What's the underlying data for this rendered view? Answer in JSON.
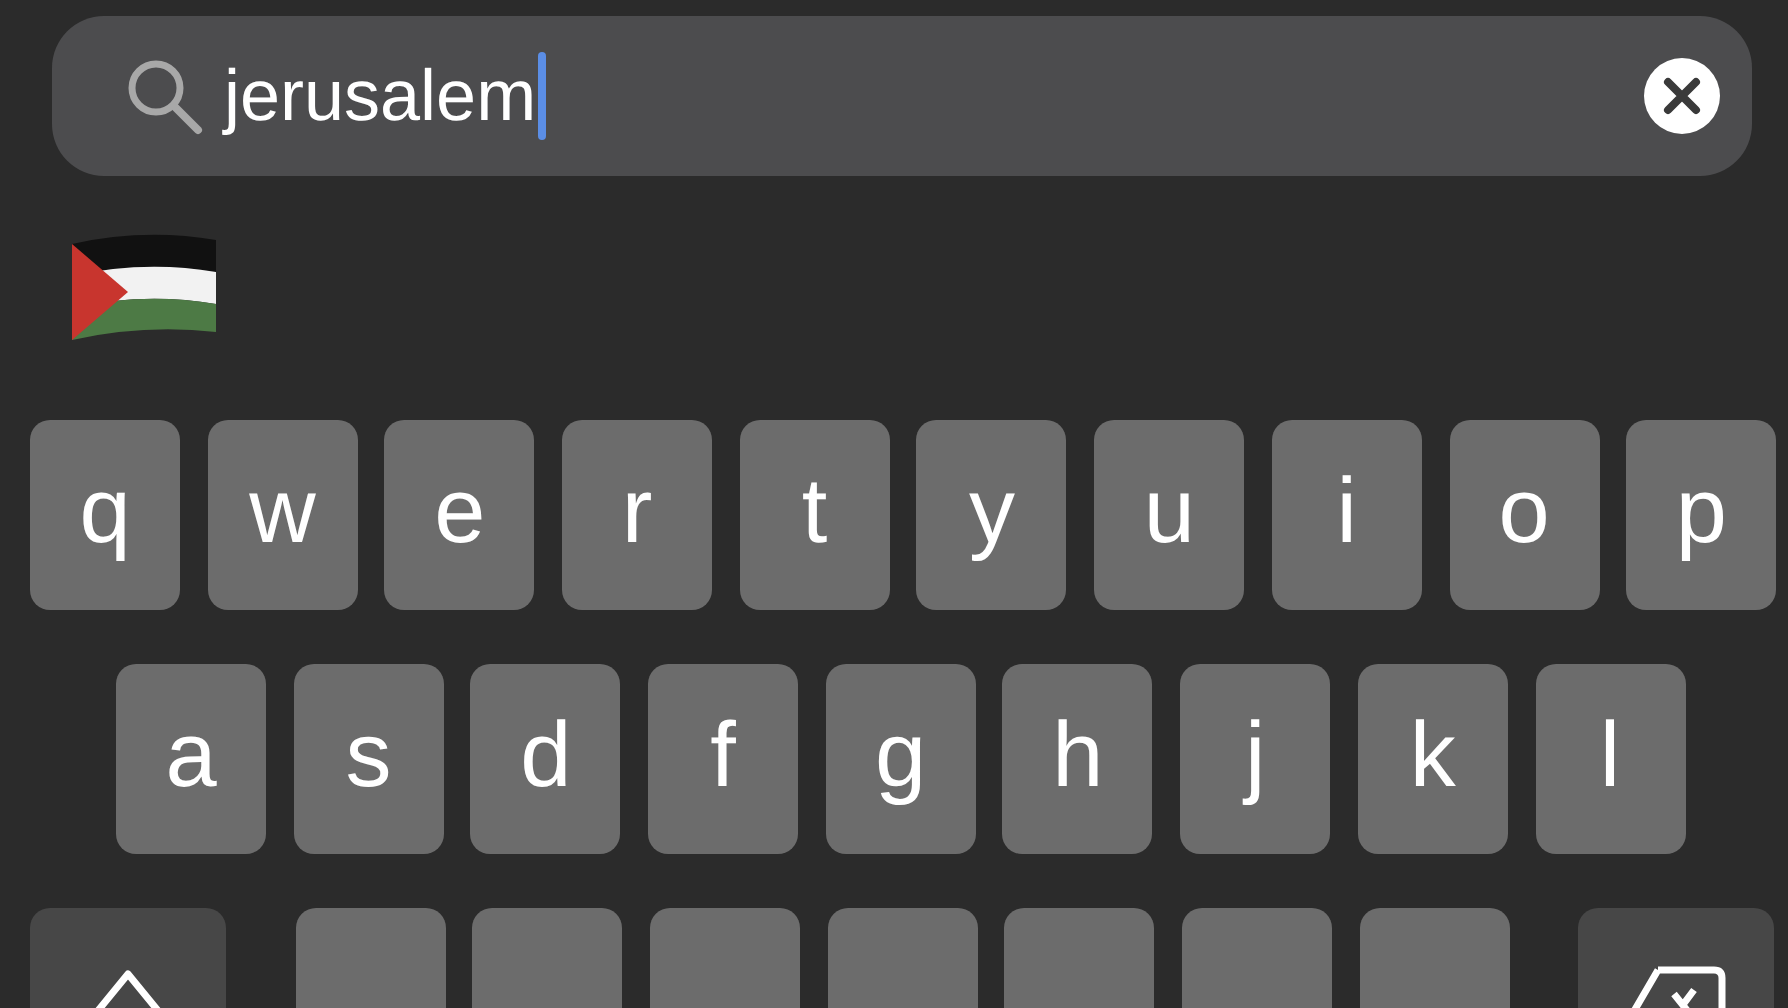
{
  "search": {
    "value": "jerusalem",
    "focused": true
  },
  "keyboard": {
    "rows": [
      {
        "keys": [
          {
            "kind": "letter",
            "label": "q"
          },
          {
            "kind": "letter",
            "label": "w"
          },
          {
            "kind": "letter",
            "label": "e"
          },
          {
            "kind": "letter",
            "label": "r"
          },
          {
            "kind": "letter",
            "label": "t"
          },
          {
            "kind": "letter",
            "label": "y"
          },
          {
            "kind": "letter",
            "label": "u"
          },
          {
            "kind": "letter",
            "label": "i"
          },
          {
            "kind": "letter",
            "label": "o"
          },
          {
            "kind": "letter",
            "label": "p"
          }
        ]
      },
      {
        "keys": [
          {
            "kind": "letter",
            "label": "a"
          },
          {
            "kind": "letter",
            "label": "s"
          },
          {
            "kind": "letter",
            "label": "d"
          },
          {
            "kind": "letter",
            "label": "f"
          },
          {
            "kind": "letter",
            "label": "g"
          },
          {
            "kind": "letter",
            "label": "h"
          },
          {
            "kind": "letter",
            "label": "j"
          },
          {
            "kind": "letter",
            "label": "k"
          },
          {
            "kind": "letter",
            "label": "l"
          }
        ]
      },
      {
        "keys": [
          {
            "kind": "shift"
          },
          {
            "kind": "letter"
          },
          {
            "kind": "letter"
          },
          {
            "kind": "letter"
          },
          {
            "kind": "letter"
          },
          {
            "kind": "letter"
          },
          {
            "kind": "letter"
          },
          {
            "kind": "letter"
          },
          {
            "kind": "delete"
          }
        ]
      }
    ]
  }
}
